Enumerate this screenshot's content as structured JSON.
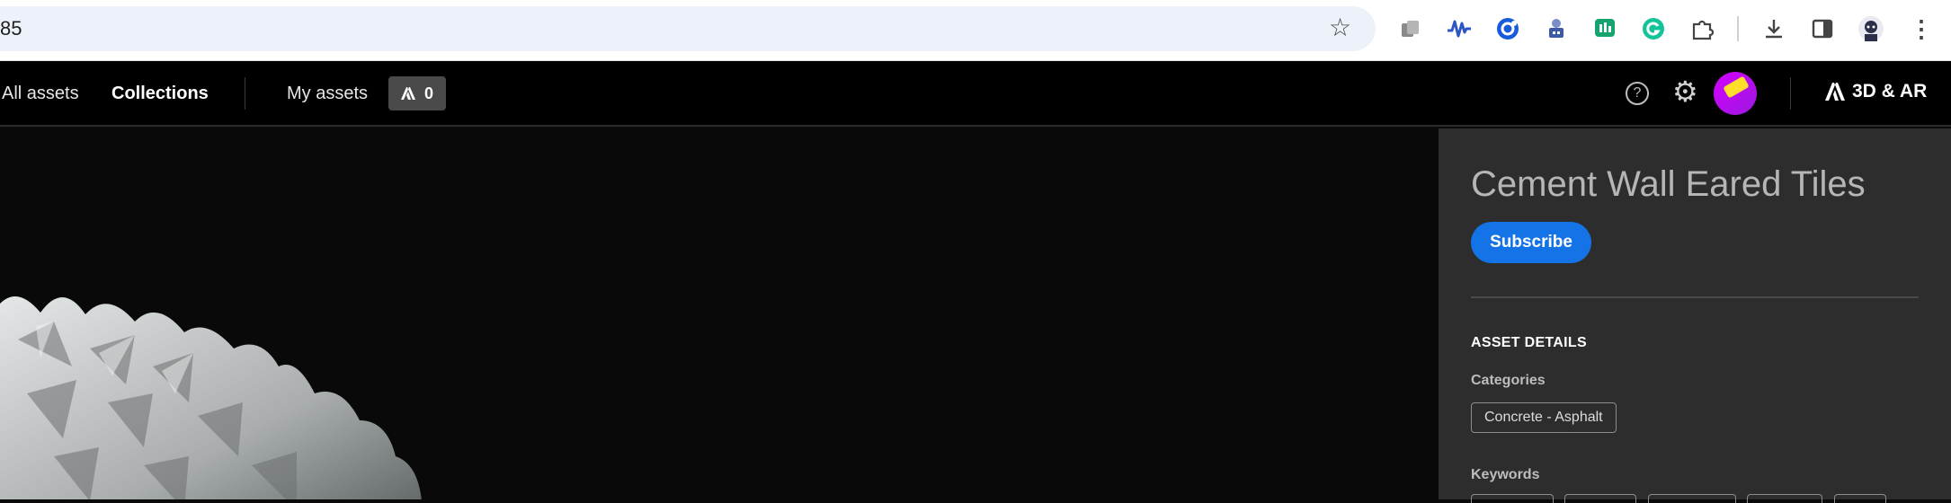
{
  "browser": {
    "url_text": "85",
    "bookmark_icon": "star-icon",
    "extension_icons": [
      "copy-stack-icon",
      "waveform-icon",
      "circle-g-icon",
      "robot-icon",
      "chat-bars-icon",
      "grammarly-icon",
      "puzzle-icon",
      "download-icon",
      "sidepanel-icon",
      "profile-icon",
      "kebab-menu-icon"
    ]
  },
  "header": {
    "nav": {
      "all_assets": "All assets",
      "collections": "Collections",
      "my_assets": "My assets"
    },
    "cart_count": "0",
    "brand_label": "3D & AR",
    "help_icon": "help-circle-icon",
    "settings_icon": "gear-icon",
    "avatar_icon": "avatar"
  },
  "asset": {
    "title": "Cement Wall Eared Tiles",
    "subscribe_label": "Subscribe",
    "details_heading": "ASSET DETAILS",
    "categories_label": "Categories",
    "categories": [
      "Concrete - Asphalt"
    ],
    "keywords_label": "Keywords"
  },
  "colors": {
    "accent": "#1473e6",
    "app_bg": "#000000",
    "panel_bg": "#2d2d2d"
  }
}
